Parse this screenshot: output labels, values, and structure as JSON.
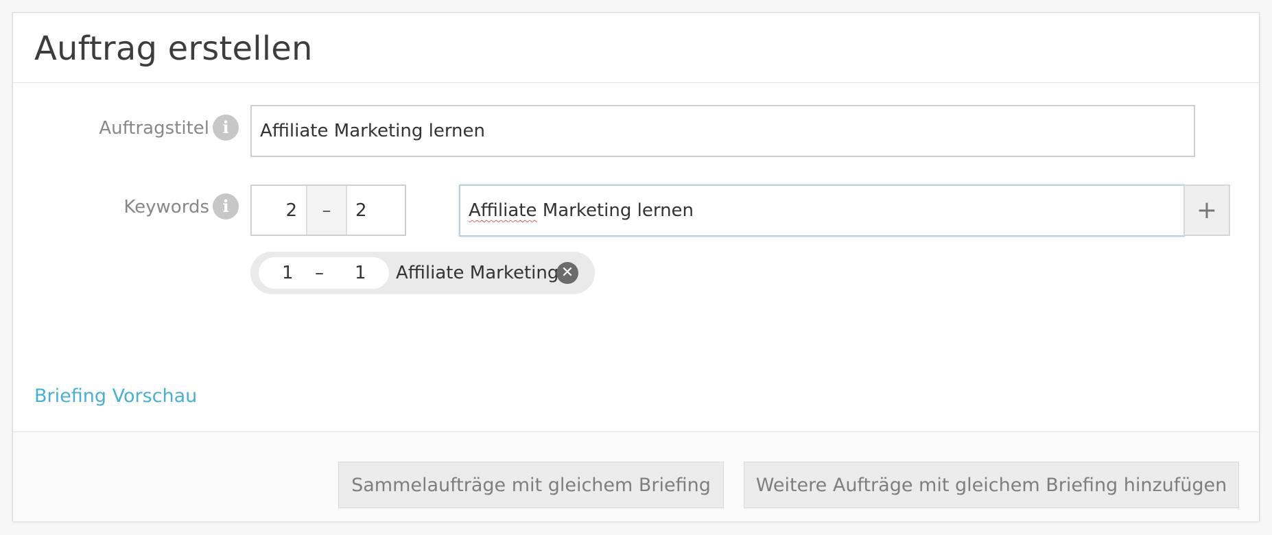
{
  "page": {
    "title": "Auftrag erstellen"
  },
  "form": {
    "title_field": {
      "label": "Auftragstitel",
      "info_icon": "info-icon",
      "value": "Affiliate Marketing lernen"
    },
    "keywords_field": {
      "label": "Keywords",
      "info_icon": "info-icon",
      "range_min": "2",
      "range_separator": "–",
      "range_max": "2",
      "value": "Affiliate Marketing lernen",
      "value_misspelled_part": "Affiliate",
      "value_rest": " Marketing lernen",
      "add_label": "+"
    },
    "keyword_chips": [
      {
        "range_min": "1",
        "range_separator": "–",
        "range_max": "1",
        "label": "Affiliate Marketing",
        "remove_icon": "close-circle-icon",
        "remove_glyph": "✕"
      }
    ]
  },
  "links": {
    "briefing_preview": "Briefing Vorschau"
  },
  "footer": {
    "batch_button": "Sammelaufträge mit gleichem Briefing",
    "add_more_button": "Weitere Aufträge mit gleichem Briefing hinzufügen"
  },
  "colors": {
    "link": "#4ab0d3",
    "label": "#888888",
    "button_bg": "#ececec",
    "info_icon_bg": "#c7c7c7"
  }
}
